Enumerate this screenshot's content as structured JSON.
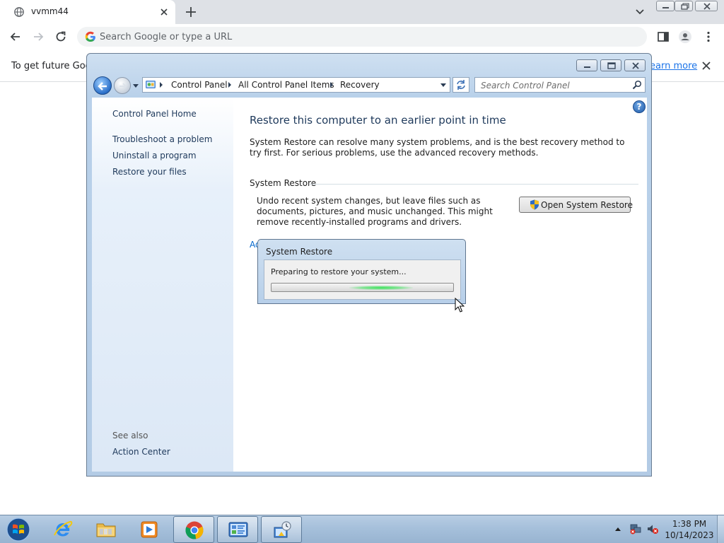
{
  "browser": {
    "tab_title": "vvmm44",
    "omnibox_placeholder": "Search Google or type a URL",
    "infobar_text": "To get future Goog",
    "infobar_link": "Learn more"
  },
  "control_panel": {
    "breadcrumbs": [
      "Control Panel",
      "All Control Panel Items",
      "Recovery"
    ],
    "search_placeholder": "Search Control Panel",
    "sidebar": {
      "home": "Control Panel Home",
      "links": [
        "Troubleshoot a problem",
        "Uninstall a program",
        "Restore your files"
      ],
      "see_also_label": "See also",
      "see_also_link": "Action Center"
    },
    "main": {
      "title": "Restore this computer to an earlier point in time",
      "description": "System Restore can resolve many system problems, and is the best recovery method to try first. For serious problems, use the advanced recovery methods.",
      "section_heading": "System Restore",
      "section_text": "Undo recent system changes, but leave files such as documents, pictures, and music unchanged. This might remove recently-installed programs and drivers.",
      "open_button": "Open System Restore",
      "advanced_link": "Ad"
    }
  },
  "dialog": {
    "title": "System Restore",
    "message": "Preparing to restore your system...",
    "progress_style": "marquee"
  },
  "taskbar": {
    "apps": [
      "internet-explorer-icon",
      "explorer-icon",
      "media-player-icon",
      "chrome-icon",
      "control-panel-icon",
      "system-restore-icon"
    ],
    "time": "1:38 PM",
    "date": "10/14/2023"
  },
  "colors": {
    "link": "#1a73e8",
    "cp_link": "#1e395b",
    "title_blue": "#1e395b",
    "progress_green": "#3be25a",
    "taskbar": "#a6c0db"
  }
}
